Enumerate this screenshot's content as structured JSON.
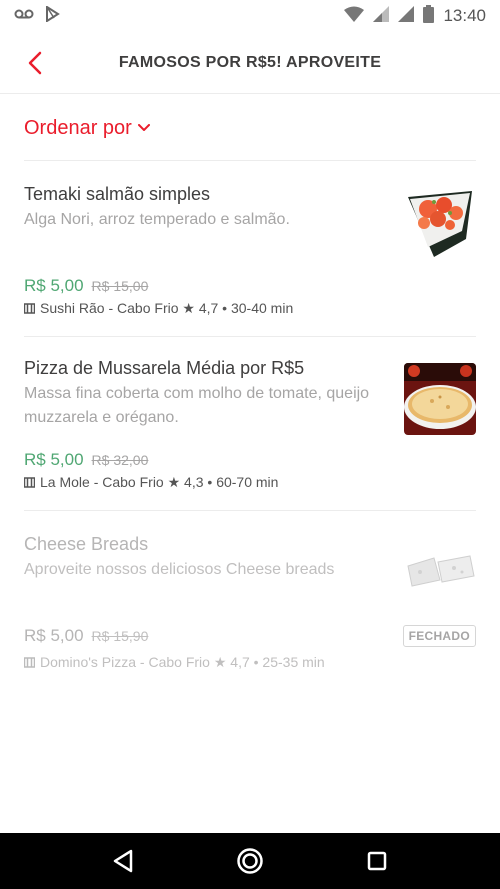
{
  "status_bar": {
    "time": "13:40"
  },
  "header": {
    "title": "FAMOSOS POR R$5! APROVEITE"
  },
  "sort": {
    "label": "Ordenar por"
  },
  "items": [
    {
      "name": "Temaki salmão simples",
      "description": "Alga Nori, arroz temperado e salmão.",
      "price": "R$ 5,00",
      "old_price": "R$ 15,00",
      "store": "Sushi Rão - Cabo Frio ★ 4,7 • 30-40 min",
      "status": "open"
    },
    {
      "name": "Pizza de Mussarela Média por R$5",
      "description": "Massa fina coberta com molho de tomate, queijo muzzarela e orégano.",
      "price": "R$ 5,00",
      "old_price": "R$ 32,00",
      "store": "La Mole - Cabo Frio ★ 4,3 • 60-70 min",
      "status": "open"
    },
    {
      "name": "Cheese Breads",
      "description": "Aproveite nossos deliciosos Cheese breads",
      "price": "R$ 5,00",
      "old_price": "R$ 15,90",
      "store": "Domino's Pizza - Cabo Frio ★ 4,7 • 25-35 min",
      "status": "closed",
      "badge": "FECHADO"
    }
  ],
  "colors": {
    "accent": "#ea1d2c",
    "price": "#50a773"
  }
}
